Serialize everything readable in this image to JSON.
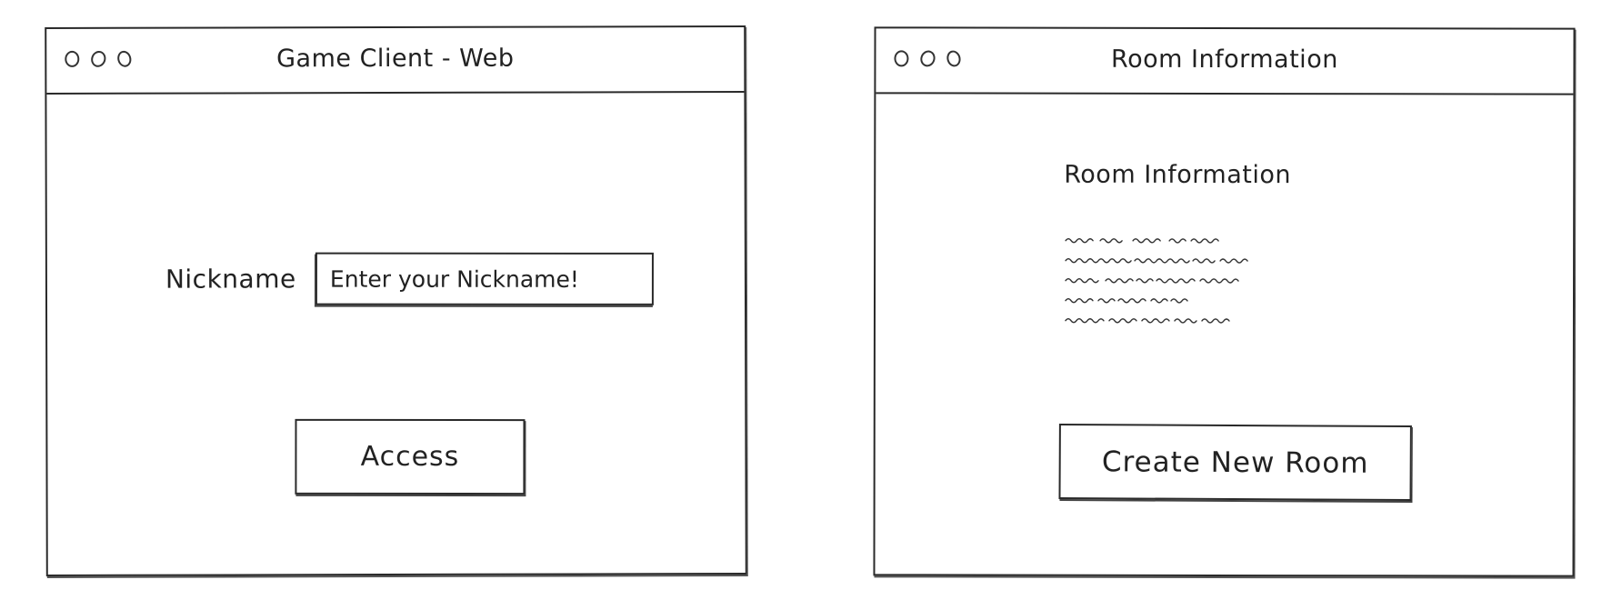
{
  "login_window": {
    "title": "Game Client - Web",
    "nickname": {
      "label": "Nickname",
      "placeholder": "Enter your Nickname!",
      "value": ""
    },
    "access_button": "Access"
  },
  "room_window": {
    "title": "Room Information",
    "heading": "Room Information",
    "create_button": "Create New Room"
  },
  "colors": {
    "stroke": "#2a2a2a",
    "background": "#ffffff"
  }
}
